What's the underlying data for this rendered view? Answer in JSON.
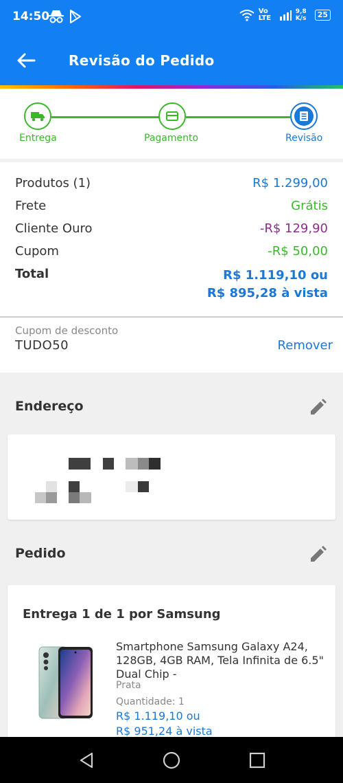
{
  "status_bar": {
    "time": "14:50",
    "network": "Vo LTE",
    "speed": "9,8 K/s",
    "battery": "25"
  },
  "header": {
    "title": "Revisão do Pedido",
    "back_icon": "arrow-left-icon"
  },
  "stepper": {
    "steps": [
      {
        "label": "Entrega",
        "icon": "truck-icon"
      },
      {
        "label": "Pagamento",
        "icon": "card-icon"
      },
      {
        "label": "Revisão",
        "icon": "list-icon"
      }
    ],
    "colors": {
      "done": "#3ab82a",
      "active": "#1a78d6"
    }
  },
  "summary": {
    "rows": [
      {
        "label": "Produtos (1)",
        "value": "R$ 1.299,00",
        "color": "#1a78d6"
      },
      {
        "label": "Frete",
        "value": "Grátis",
        "color": "#3ab82a"
      },
      {
        "label": "Cliente Ouro",
        "value": "-R$ 129,90",
        "color": "#8e2d8e"
      },
      {
        "label": "Cupom",
        "value": "-R$ 50,00",
        "color": "#3ab82a"
      }
    ],
    "total_label": "Total",
    "total_line1": "R$ 1.119,10 ou",
    "total_line2": "R$ 895,28 à vista"
  },
  "coupon": {
    "label": "Cupom de desconto",
    "code": "TUDO50",
    "remove_label": "Remover"
  },
  "address": {
    "title": "Endereço"
  },
  "order": {
    "title": "Pedido",
    "delivery": "Entrega 1 de 1 por Samsung",
    "product_name": "Smartphone Samsung Galaxy A24, 128GB, 4GB RAM, Tela Infinita de 6.5\" Dual Chip -",
    "variant": "Prata",
    "quantity": "Quantidade: 1",
    "price_line1": "R$ 1.119,10 ou",
    "price_line2": "R$ 951,24 à vista"
  },
  "colors": {
    "brand": "#1280f2",
    "price_blue": "#1a78d6",
    "green": "#3ab82a",
    "purple": "#8e2d8e"
  }
}
